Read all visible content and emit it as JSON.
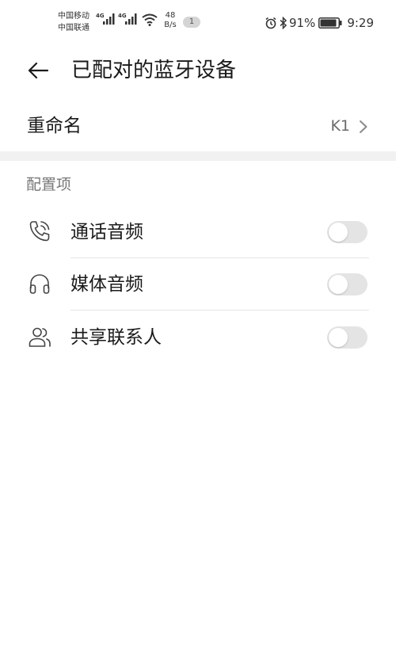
{
  "status_bar": {
    "carrier_1": "中国移动",
    "carrier_2": "中国联通",
    "network_tag": "4G",
    "net_speed_value": "48",
    "net_speed_unit": "B/s",
    "notification_count": "1",
    "battery_percent": "91%",
    "battery_level": 0.91,
    "time": "9:29"
  },
  "app_bar": {
    "title": "已配对的蓝牙设备",
    "back_icon": "arrow-left-icon"
  },
  "rename": {
    "label": "重命名",
    "value": "K1"
  },
  "config_section": {
    "title": "配置项",
    "items": [
      {
        "label": "通话音频",
        "icon": "phone-icon",
        "enabled": false
      },
      {
        "label": "媒体音频",
        "icon": "headphones-icon",
        "enabled": false
      },
      {
        "label": "共享联系人",
        "icon": "contacts-icon",
        "enabled": false
      }
    ]
  },
  "colors": {
    "toggle_off_track": "#e4e4e4",
    "section_band": "#f1f1f1",
    "secondary_text": "#777777"
  }
}
